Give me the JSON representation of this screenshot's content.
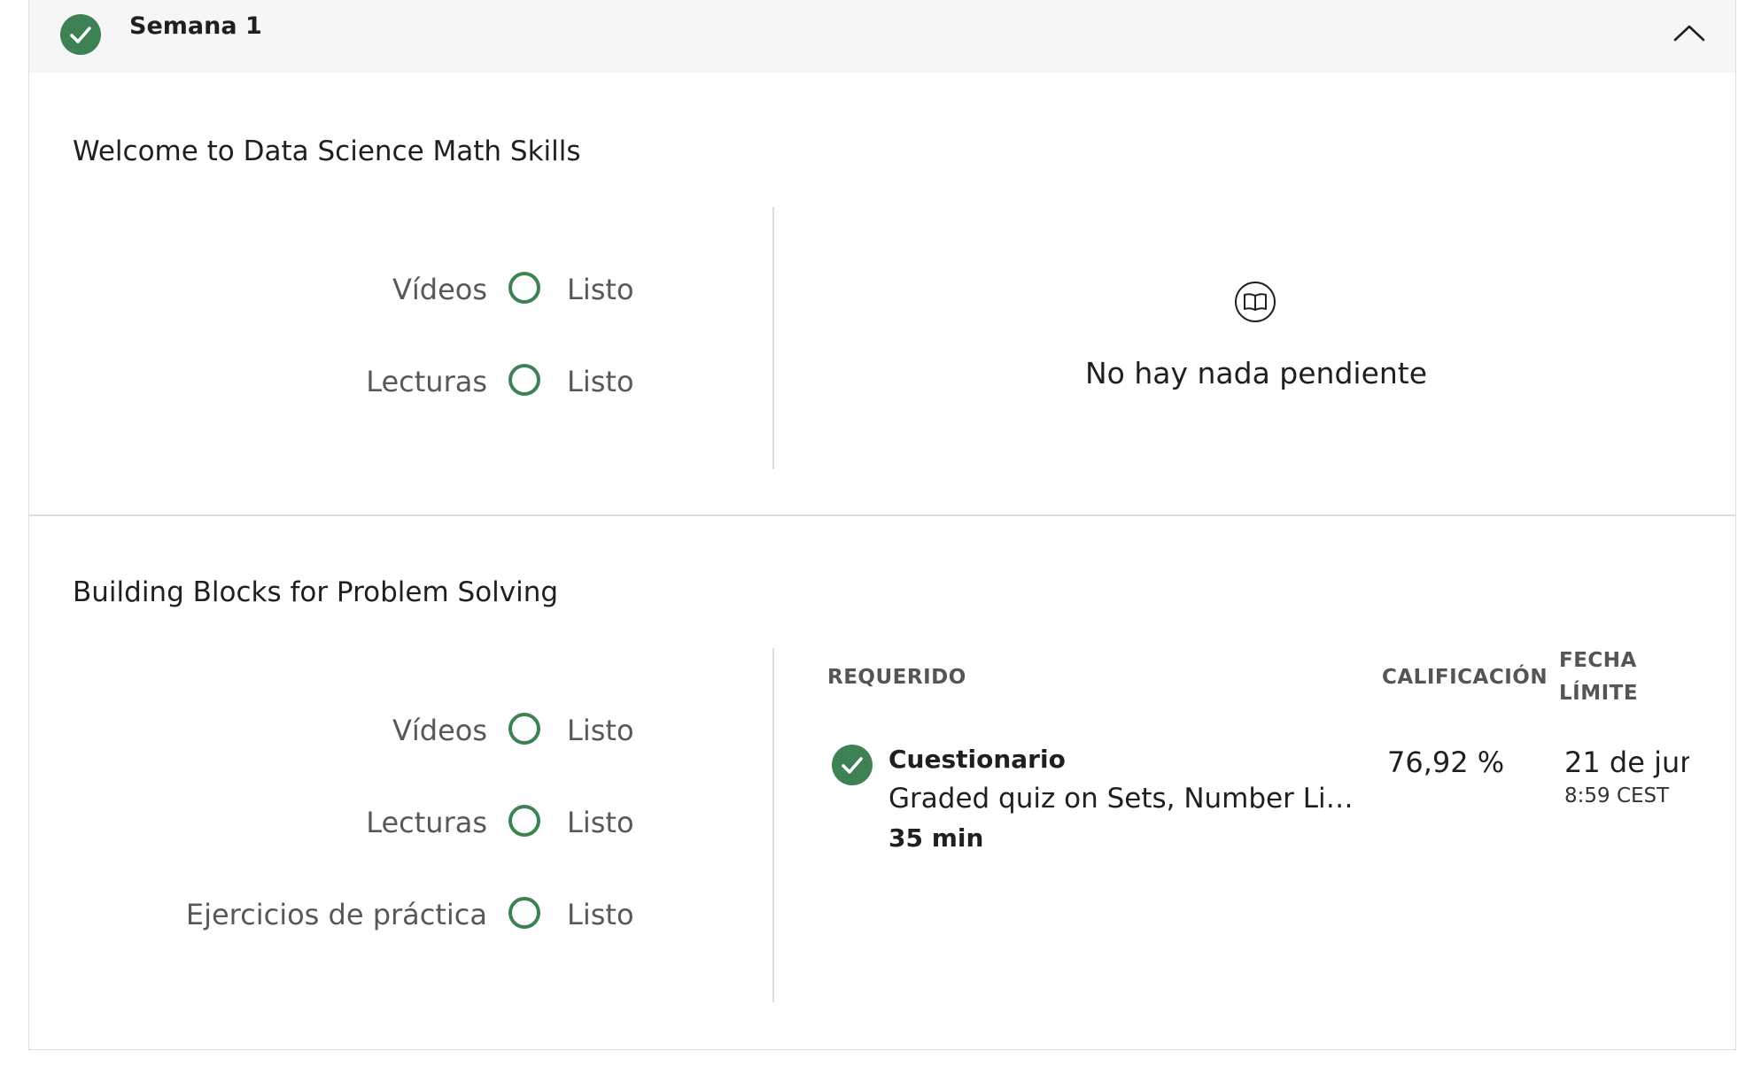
{
  "week": {
    "title": "Semana 1",
    "completed": true,
    "collapse_icon": "chevron-up-icon"
  },
  "modules": [
    {
      "title": "Welcome to Data Science Math Skills",
      "stats": [
        {
          "label": "Vídeos",
          "status": "Listo"
        },
        {
          "label": "Lecturas",
          "status": "Listo"
        }
      ],
      "empty_icon": "book-icon",
      "empty_text": "No hay nada pendiente"
    },
    {
      "title": "Building Blocks for Problem Solving",
      "stats": [
        {
          "label": "Vídeos",
          "status": "Listo"
        },
        {
          "label": "Lecturas",
          "status": "Listo"
        },
        {
          "label": "Ejercicios de práctica",
          "status": "Listo"
        }
      ],
      "table": {
        "headers": {
          "required": "REQUERIDO",
          "grade": "CALIFICACIÓN",
          "due_line1": "FECHA",
          "due_line2": "LÍMITE"
        },
        "rows": [
          {
            "type": "Cuestionario",
            "name": "Graded quiz on Sets, Number Lin...",
            "duration": "35 min",
            "grade": "76,92 %",
            "due_date": "21 de jun.",
            "due_time": "8:59 CEST",
            "completed": true
          }
        ]
      }
    }
  ],
  "colors": {
    "accent_green": "#3d8155",
    "header_bg": "#f6f6f6",
    "divider": "#dedede",
    "muted_text": "#585858"
  }
}
